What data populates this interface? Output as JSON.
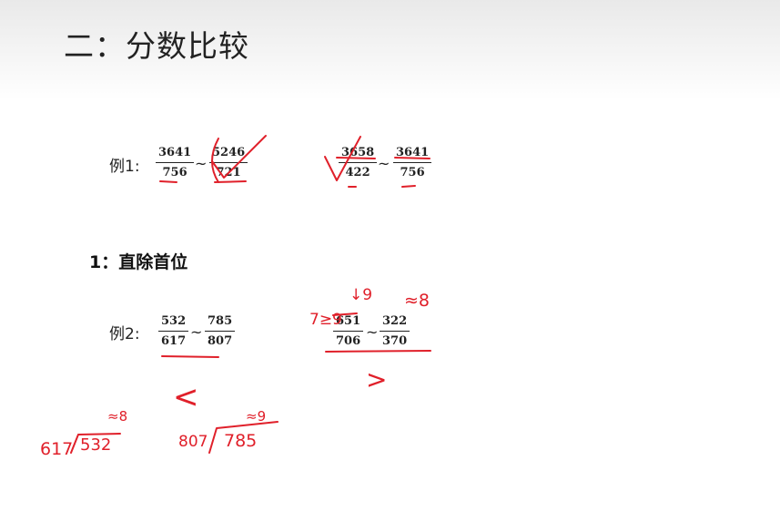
{
  "title": "二：分数比较",
  "example1": {
    "label": "例1:",
    "pair_a": {
      "left": {
        "num": "3641",
        "den": "756"
      },
      "right": {
        "num": "5246",
        "den": "721"
      }
    },
    "pair_b": {
      "left": {
        "num": "3658",
        "den": "422"
      },
      "right": {
        "num": "3641",
        "den": "756"
      }
    }
  },
  "method_heading": "1：直除首位",
  "example2": {
    "label": "例2:",
    "pair_a": {
      "left": {
        "num": "532",
        "den": "617"
      },
      "right": {
        "num": "785",
        "den": "807"
      }
    },
    "pair_b": {
      "left": {
        "num": "651",
        "den": "706"
      },
      "right": {
        "num": "322",
        "den": "370"
      }
    }
  },
  "tilde": "~",
  "handwriting": {
    "color": "#e0202a",
    "ex2b_left_note": "7≥9",
    "ex2b_top_note": "↓9",
    "ex2b_right_note": "≈8",
    "div1_divisor": "617",
    "div1_dividend": "532",
    "div1_quotient": "≈8",
    "div2_divisor": "807",
    "div2_dividend": "785",
    "div2_quotient": "≈9",
    "less_than": "<",
    "greater_than": ">"
  }
}
